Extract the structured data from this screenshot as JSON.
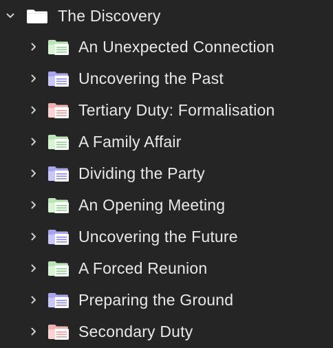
{
  "root": {
    "label": "The Discovery",
    "expanded": true,
    "icon": "folder-icon",
    "color": "#ffffff"
  },
  "items": [
    {
      "label": "An Unexpected Connection",
      "icon": "chapter-folder-icon",
      "color": "green"
    },
    {
      "label": "Uncovering the Past",
      "icon": "chapter-folder-icon",
      "color": "purple"
    },
    {
      "label": "Tertiary Duty: Formalisation",
      "icon": "chapter-folder-icon",
      "color": "pink"
    },
    {
      "label": "A Family Affair",
      "icon": "chapter-folder-icon",
      "color": "green"
    },
    {
      "label": "Dividing the Party",
      "icon": "chapter-folder-icon",
      "color": "purple"
    },
    {
      "label": "An Opening Meeting",
      "icon": "chapter-folder-icon",
      "color": "green"
    },
    {
      "label": "Uncovering the Future",
      "icon": "chapter-folder-icon",
      "color": "purple"
    },
    {
      "label": "A Forced Reunion",
      "icon": "chapter-folder-icon",
      "color": "green"
    },
    {
      "label": "Preparing the Ground",
      "icon": "chapter-folder-icon",
      "color": "purple"
    },
    {
      "label": "Secondary Duty",
      "icon": "chapter-folder-icon",
      "color": "pink"
    }
  ],
  "palette": {
    "green": {
      "back": "#b9e6b4",
      "front": "#d9f4d2",
      "lines": "#8fd08d"
    },
    "purple": {
      "back": "#a8a5ee",
      "front": "#c9c7f7",
      "lines": "#8c88e6"
    },
    "pink": {
      "back": "#efb2b2",
      "front": "#fbd3d3",
      "lines": "#e69a9a"
    }
  }
}
